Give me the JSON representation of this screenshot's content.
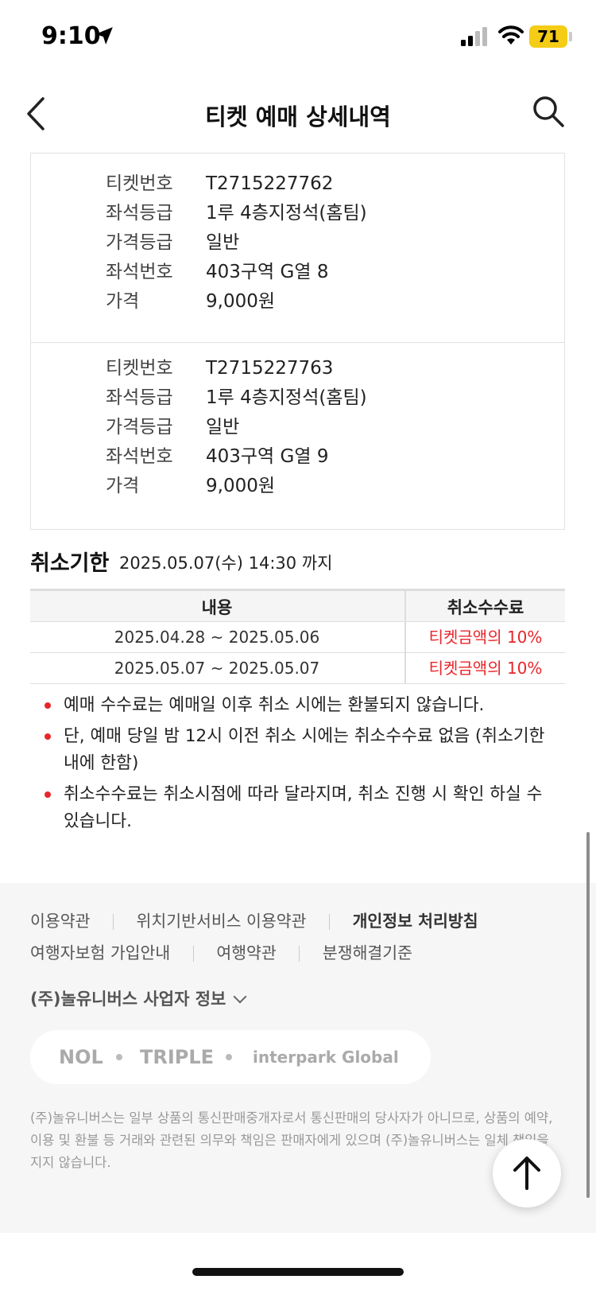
{
  "status_bar": {
    "time": "9:10",
    "battery": "71"
  },
  "header": {
    "title": "티켓 예매 상세내역"
  },
  "tickets": [
    {
      "rows": [
        {
          "label": "티켓번호",
          "value": "T2715227762"
        },
        {
          "label": "좌석등급",
          "value": "1루 4층지정석(홈팀)"
        },
        {
          "label": "가격등급",
          "value": "일반"
        },
        {
          "label": "좌석번호",
          "value": "403구역 G열 8"
        },
        {
          "label": "가격",
          "value": "9,000원"
        }
      ]
    },
    {
      "rows": [
        {
          "label": "티켓번호",
          "value": "T2715227763"
        },
        {
          "label": "좌석등급",
          "value": "1루 4층지정석(홈팀)"
        },
        {
          "label": "가격등급",
          "value": "일반"
        },
        {
          "label": "좌석번호",
          "value": "403구역 G열 9"
        },
        {
          "label": "가격",
          "value": "9,000원"
        }
      ]
    }
  ],
  "cancel": {
    "heading": "취소기한",
    "deadline": "2025.05.07(수) 14:30 까지",
    "table": {
      "headers": [
        "내용",
        "취소수수료"
      ],
      "rows": [
        [
          "2025.04.28 ~ 2025.05.06",
          "티켓금액의 10%"
        ],
        [
          "2025.05.07 ~ 2025.05.07",
          "티켓금액의 10%"
        ]
      ]
    },
    "notes": [
      "예매 수수료는 예매일 이후 취소 시에는 환불되지 않습니다.",
      "단, 예매 당일 밤 12시 이전 취소 시에는 취소수수료 없음 (취소기한 내에 한함)",
      "취소수수료는 취소시점에 따라 달라지며, 취소 진행 시 확인 하실 수 있습니다."
    ]
  },
  "footer": {
    "links_line1": [
      "이용약관",
      "위치기반서비스 이용약관",
      "개인정보 처리방침"
    ],
    "links_line2": [
      "여행자보험 가입안내",
      "여행약관",
      "분쟁해결기준"
    ],
    "business_info": "(주)놀유니버스 사업자 정보",
    "brands": [
      "NOL",
      "TRIPLE",
      "interpark Global"
    ],
    "disclaimer": "(주)놀유니버스는 일부 상품의 통신판매중개자로서 통신판매의 당사자가 아니므로, 상품의 예약, 이용 및 환불 등 거래와 관련된 의무와 책임은 판매자에게 있으며 (주)놀유니버스는 일체 책임을 지지 않습니다."
  },
  "colors": {
    "accent_red": "#e8262a",
    "battery_yellow": "#f5cc16"
  },
  "icons": [
    "location-arrow-icon",
    "signal-icon",
    "wifi-icon",
    "back-chevron-icon",
    "search-icon",
    "arrow-up-icon"
  ]
}
